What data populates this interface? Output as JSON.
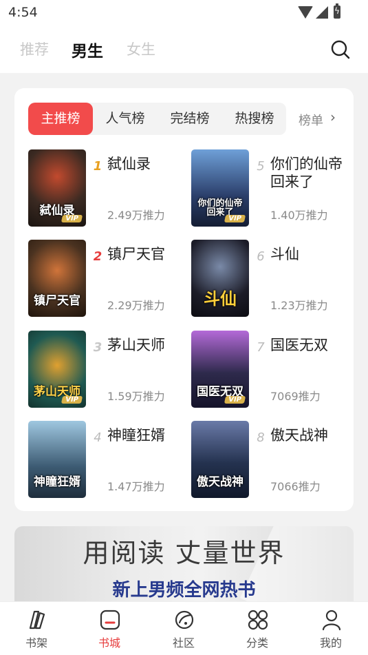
{
  "status": {
    "time": "4:54"
  },
  "top_tabs": [
    {
      "label": "推荐",
      "active": false
    },
    {
      "label": "男生",
      "active": true
    },
    {
      "label": "女生",
      "active": false
    }
  ],
  "rank_tabs": [
    {
      "label": "主推榜",
      "active": true
    },
    {
      "label": "人气榜",
      "active": false
    },
    {
      "label": "完结榜",
      "active": false
    },
    {
      "label": "热搜榜",
      "active": false
    }
  ],
  "rank_more": "榜单",
  "books": [
    {
      "rank": "1",
      "title": "弑仙录",
      "heat": "2.49万推力",
      "cover_text": "弑仙录",
      "cover_bg": "#3b2a22"
    },
    {
      "rank": "2",
      "title": "镇尸天官",
      "heat": "2.29万推力",
      "cover_text": "镇尸天官",
      "cover_bg": "#4a3220"
    },
    {
      "rank": "3",
      "title": "茅山天师",
      "heat": "1.59万推力",
      "cover_text": "茅山天师",
      "cover_bg": "#1f5a52"
    },
    {
      "rank": "4",
      "title": "神瞳狂婿",
      "heat": "1.47万推力",
      "cover_text": "神瞳狂婿",
      "cover_bg": "#3c5a72"
    },
    {
      "rank": "5",
      "title": "你们的仙帝回来了",
      "heat": "1.40万推力",
      "cover_text": "你们的仙帝回来了",
      "cover_bg": "#2b3f6b"
    },
    {
      "rank": "6",
      "title": "斗仙",
      "heat": "1.23万推力",
      "cover_text": "斗仙",
      "cover_bg": "#1c1c28"
    },
    {
      "rank": "7",
      "title": "国医无双",
      "heat": "7069推力",
      "cover_text": "国医无双",
      "cover_bg": "#2e2a4c"
    },
    {
      "rank": "8",
      "title": "傲天战神",
      "heat": "7066推力",
      "cover_text": "傲天战神",
      "cover_bg": "#24324f"
    }
  ],
  "banner": {
    "headline": "用阅读 丈量世界",
    "subline": "新上男频全网热书"
  },
  "bottom_nav": [
    {
      "label": "书架",
      "icon": "bookshelf-icon",
      "active": false
    },
    {
      "label": "书城",
      "icon": "bookstore-icon",
      "active": true
    },
    {
      "label": "社区",
      "icon": "community-icon",
      "active": false
    },
    {
      "label": "分类",
      "icon": "category-icon",
      "active": false
    },
    {
      "label": "我的",
      "icon": "profile-icon",
      "active": false
    }
  ],
  "colors": {
    "accent": "#f24b4b",
    "active_nav": "#e63c3c",
    "banner_text": "#273a8e"
  }
}
